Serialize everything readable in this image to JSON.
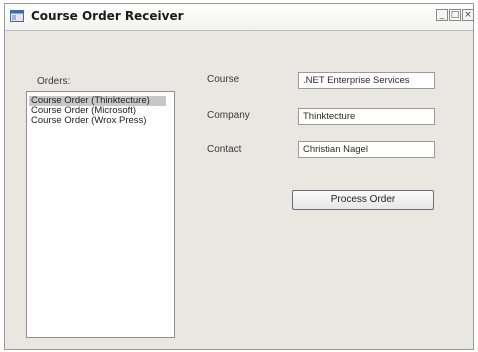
{
  "window": {
    "title": "Course Order Receiver",
    "controls": {
      "minimize": "_",
      "maximize": "□",
      "close": "×"
    },
    "app_icon": "window-app-icon"
  },
  "orders": {
    "label": "Orders:",
    "items": [
      "Course Order (Thinktecture)",
      "Course Order (Microsoft)",
      "Course Order (Wrox Press)"
    ],
    "selected_index": 0
  },
  "fields": {
    "course_label": "Course",
    "course_value": ".NET Enterprise Services",
    "company_label": "Company",
    "company_value": "Thinktecture",
    "contact_label": "Contact",
    "contact_value": "Christian Nagel"
  },
  "actions": {
    "process_order_label": "Process Order"
  }
}
